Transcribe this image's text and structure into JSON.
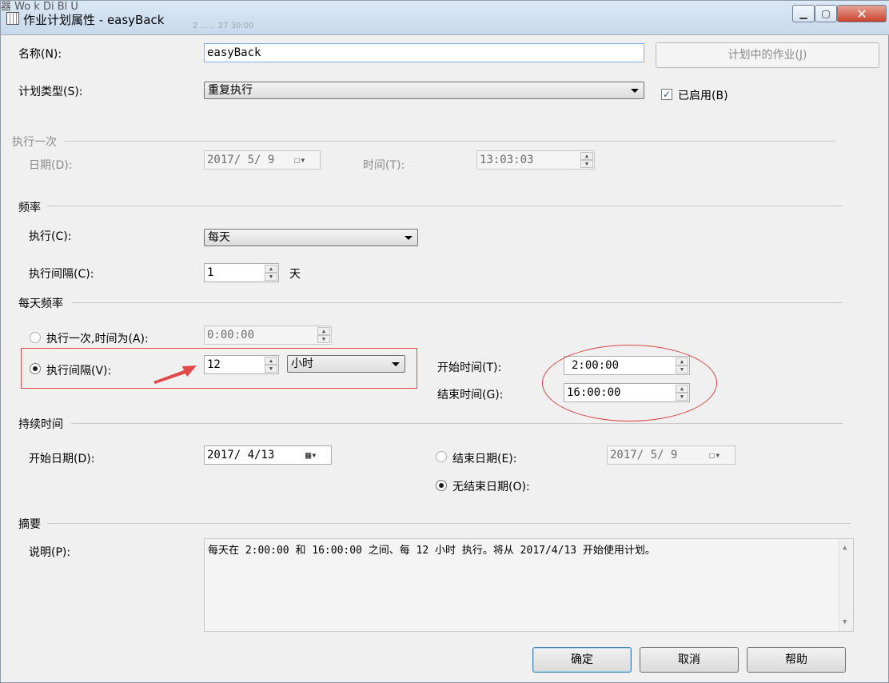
{
  "window": {
    "title": "作业计划属性 - easyBack",
    "behind_text": "器    Wo k   Di Bl  U",
    "behind_text2": "2 ... ..  27 30:00"
  },
  "name": {
    "label": "名称(N):",
    "value": "easyBack"
  },
  "jobs_in_schedule_button": "计划中的作业(J)",
  "schedule_type": {
    "label": "计划类型(S):",
    "value": "重复执行"
  },
  "enabled": {
    "label": "已启用(B)",
    "checked": true
  },
  "once": {
    "header": "执行一次",
    "date_label": "日期(D):",
    "date_value": "2017/ 5/ 9",
    "time_label": "时间(T):",
    "time_value": "13:03:03"
  },
  "frequency": {
    "header": "频率",
    "occurs_label": "执行(C):",
    "occurs_value": "每天",
    "recurs_label": "执行间隔(C):",
    "recurs_value": "1",
    "recurs_unit": "天"
  },
  "daily_frequency": {
    "header": "每天频率",
    "once_at_label": "执行一次,时间为(A):",
    "once_at_value": "0:00:00",
    "every_label": "执行间隔(V):",
    "every_value": "12",
    "every_unit": "小时",
    "start_label": "开始时间(T):",
    "start_value": "2:00:00",
    "end_label": "结束时间(G):",
    "end_value": "16:00:00",
    "selected": "every"
  },
  "duration": {
    "header": "持续时间",
    "start_date_label": "开始日期(D):",
    "start_date_value": "2017/ 4/13",
    "end_date_label": "结束日期(E):",
    "end_date_value": "2017/ 5/ 9",
    "no_end_label": "无结束日期(O):",
    "selected": "no_end"
  },
  "summary": {
    "header": "摘要",
    "desc_label": "说明(P):",
    "desc_value": "每天在 2:00:00 和 16:00:00 之间、每 12 小时 执行。将从 2017/4/13 开始使用计划。"
  },
  "buttons": {
    "ok": "确定",
    "cancel": "取消",
    "help": "帮助"
  },
  "annotation_colors": {
    "highlight": "#e14949"
  }
}
